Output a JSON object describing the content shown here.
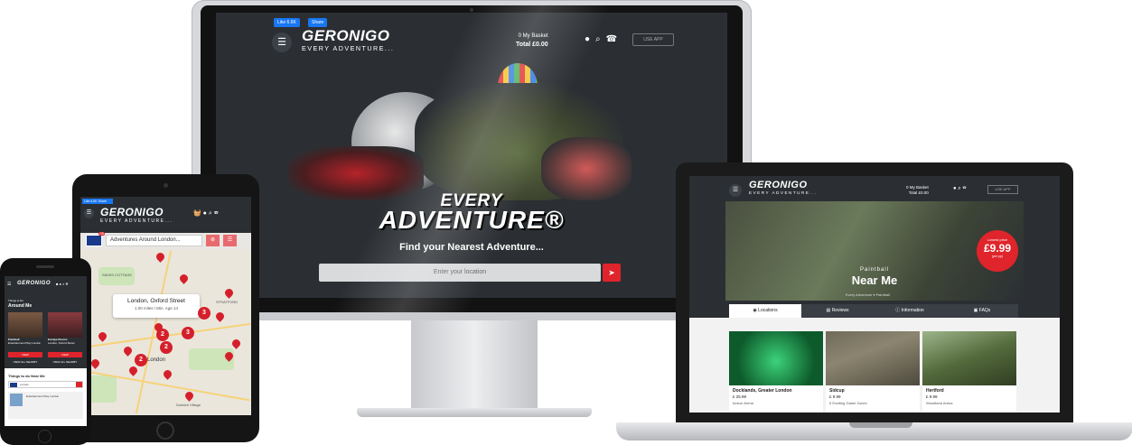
{
  "desktop": {
    "fb_like": "Like 6.6K",
    "fb_share": "Share",
    "logo": "GERONIGO",
    "logo_tag": "EVERY ADVENTURE...",
    "basket_line1": "0 My Basket",
    "basket_line2": "Total £0.00",
    "use_app": "USE APP",
    "hero_title_1": "EVERY",
    "hero_title_2": "ADVENTURE®",
    "hero_subtitle": "Find your Nearest Adventure...",
    "search_placeholder": "Enter your location",
    "menu_icon": "menu-icon",
    "location_icon": "location-arrow-icon"
  },
  "laptop": {
    "logo": "GERONIGO",
    "logo_tag": "EVERY ADVENTURE...",
    "basket_line1": "0 My Basket",
    "basket_line2": "Total £0.00",
    "use_app": "USE APP",
    "price_label": "Lowest price",
    "price_value": "£9.99",
    "price_sub": "(per pp)",
    "activity": "Paintball",
    "near_me": "Near Me",
    "breadcrumb_1": "Every Adventure",
    "breadcrumb_2": "Paintball",
    "tabs": [
      {
        "label": "Locations"
      },
      {
        "label": "Reviews"
      },
      {
        "label": "Information"
      },
      {
        "label": "FAQs"
      }
    ],
    "cards": [
      {
        "name": "Docklands, Greater London",
        "price": "£ 25.99",
        "feature": "Indoor Arena"
      },
      {
        "name": "Sidcup",
        "price": "£ 9.99",
        "feature": "5 Exciting Game Zones"
      },
      {
        "name": "Hertford",
        "price": "£ 9.99",
        "feature": "Woodland Arena"
      }
    ]
  },
  "tablet": {
    "fb": "Like 6.6K  Share",
    "logo": "GERONIGO",
    "logo_tag": "EVERY ADVENTURE...",
    "flag_badge": "GB",
    "search_value": "Adventures Around London...",
    "popup_title": "London, Oxford Street",
    "popup_sub": "1.00 miles / Min. Age 14",
    "map_labels": [
      "London",
      "STRATFORD",
      "SWISS COTTAGE",
      "Dulwich Village"
    ],
    "clusters": [
      "2",
      "3",
      "2",
      "3",
      "2"
    ]
  },
  "phone": {
    "logo": "GERONIGO",
    "things_label": "Things to Do",
    "around_me": "Around Me",
    "card1_title": "Paintball",
    "card1_sub": "Entertainment Play London",
    "card2_title": "Escape Rooms",
    "card2_sub": "London, Oxford Street",
    "view": "VIEW",
    "view_all": "VIEW ALL NEARBY",
    "bottom_title": "Things to do Near Me",
    "search_value": "London",
    "result_text": "Entertainment Play London"
  },
  "colors": {
    "accent": "#e0242b",
    "header": "#2b2f33",
    "facebook": "#1877f2"
  }
}
